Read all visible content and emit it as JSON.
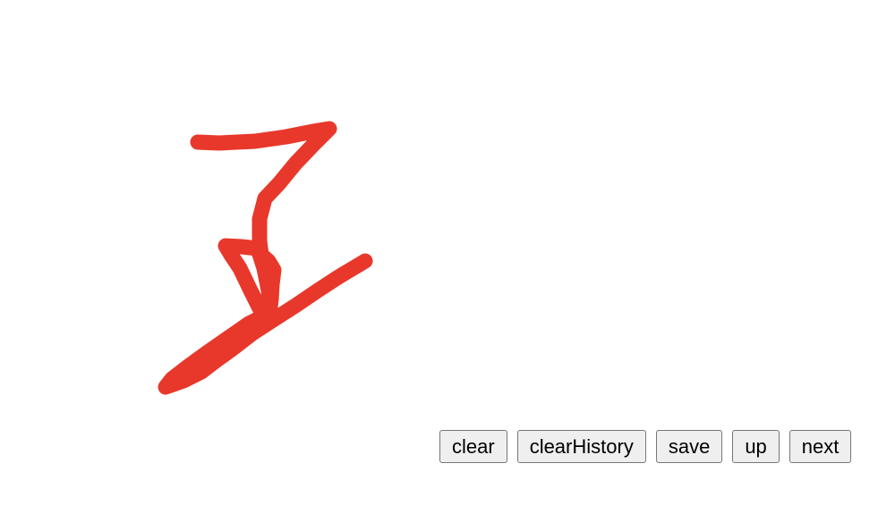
{
  "canvas": {
    "stroke_color": "#e8382b",
    "background_color": "#ffffff"
  },
  "toolbar": {
    "clear_label": "clear",
    "clear_history_label": "clearHistory",
    "save_label": "save",
    "up_label": "up",
    "next_label": "next"
  }
}
